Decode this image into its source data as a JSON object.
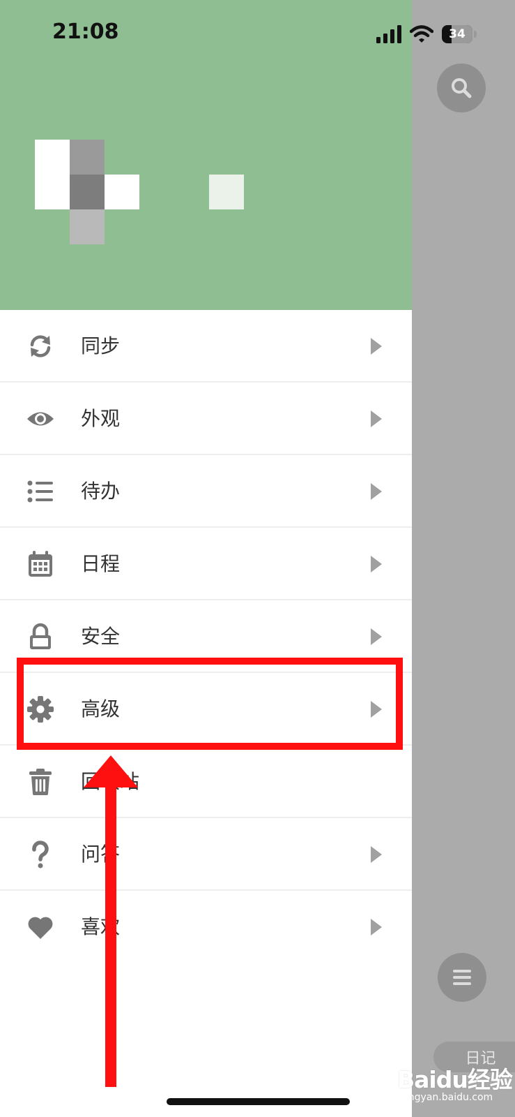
{
  "status_bar": {
    "time": "21:08",
    "battery_level": "34"
  },
  "background_app": {
    "diary_label": "日记",
    "search_icon": "search-icon",
    "menu_icon": "hamburger-menu-icon"
  },
  "drawer": {
    "header_color": "#8fbe93",
    "menu_items": [
      {
        "label": "同步",
        "icon": "sync-icon"
      },
      {
        "label": "外观",
        "icon": "eye-icon"
      },
      {
        "label": "待办",
        "icon": "list-icon"
      },
      {
        "label": "日程",
        "icon": "calendar-icon"
      },
      {
        "label": "安全",
        "icon": "lock-icon"
      },
      {
        "label": "高级",
        "icon": "gear-icon"
      },
      {
        "label": "回收站",
        "icon": "trash-icon"
      },
      {
        "label": "问答",
        "icon": "question-icon"
      },
      {
        "label": "喜欢",
        "icon": "heart-icon"
      }
    ]
  },
  "annotation": {
    "highlight_color": "#ff1010"
  },
  "watermark": {
    "brand": "Baidu经验",
    "url": "jingyan.baidu.com"
  }
}
